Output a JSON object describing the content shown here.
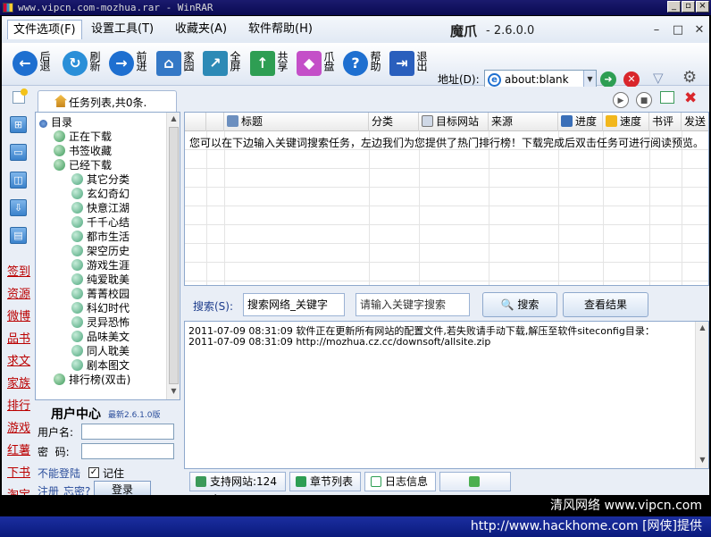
{
  "window": {
    "outer_title": "www.vipcn.com-mozhua.rar - WinRAR",
    "app_name": "魔爪",
    "app_version": "- 2.6.0.0"
  },
  "menu": [
    {
      "label": "文件选项(F)"
    },
    {
      "label": "设置工具(T)"
    },
    {
      "label": "收藏夹(A)"
    },
    {
      "label": "软件帮助(H)"
    }
  ],
  "toolbar": [
    {
      "label": "后退",
      "icon": "back-arrow-icon",
      "color": "#1e6fd0"
    },
    {
      "label": "刷新",
      "icon": "refresh-icon",
      "color": "#2a8fd8"
    },
    {
      "label": "前进",
      "icon": "forward-arrow-icon",
      "color": "#1e6fd0"
    },
    {
      "label": "家园",
      "icon": "home-icon",
      "color": "#3478c6"
    },
    {
      "label": "全屏",
      "icon": "fullscreen-icon",
      "color": "#2d8ab6"
    },
    {
      "label": "共享",
      "icon": "share-icon",
      "color": "#2e9e53"
    },
    {
      "label": "爪盘",
      "icon": "cube-icon",
      "color": "#c44fc8"
    },
    {
      "label": "帮助",
      "icon": "help-icon",
      "color": "#1e6fd0"
    },
    {
      "label": "退出",
      "icon": "exit-icon",
      "color": "#2a5fbd"
    }
  ],
  "address": {
    "label": "地址(D):",
    "value": "about:blank"
  },
  "task_tab": {
    "label": "任务列表,共0条."
  },
  "sidebar_links": [
    "签到",
    "资源",
    "微博",
    "品书",
    "求文",
    "家族",
    "排行",
    "游戏",
    "红薯",
    "下书",
    "淘宝"
  ],
  "tree": {
    "root": "目录",
    "items": [
      {
        "label": "正在下载",
        "level": 1
      },
      {
        "label": "书签收藏",
        "level": 1
      },
      {
        "label": "已经下载",
        "level": 1
      },
      {
        "label": "其它分类",
        "level": 2
      },
      {
        "label": "玄幻奇幻",
        "level": 2
      },
      {
        "label": "快意江湖",
        "level": 2
      },
      {
        "label": "千千心结",
        "level": 2
      },
      {
        "label": "都市生活",
        "level": 2
      },
      {
        "label": "架空历史",
        "level": 2
      },
      {
        "label": "游戏生涯",
        "level": 2
      },
      {
        "label": "纯爱耽美",
        "level": 2
      },
      {
        "label": "菁菁校园",
        "level": 2
      },
      {
        "label": "科幻时代",
        "level": 2
      },
      {
        "label": "灵异恐怖",
        "level": 2
      },
      {
        "label": "品味美文",
        "level": 2
      },
      {
        "label": "同人耽美",
        "level": 2
      },
      {
        "label": "剧本图文",
        "level": 2
      },
      {
        "label": "排行榜(双击)",
        "level": 1
      }
    ]
  },
  "user_center": {
    "title": "用户中心",
    "version": "最新2.6.1.0版",
    "username_label": "用户名:",
    "password_label": "密  码:",
    "cannot_login": "不能登陆",
    "remember": "记住",
    "register": "注册",
    "forgot": "忘密?",
    "login": "登录"
  },
  "grid": {
    "columns": [
      "标题",
      "分类",
      "目标网站",
      "来源",
      "进度",
      "速度",
      "书评",
      "发送"
    ],
    "message": "您可以在下边输入关键词搜索任务，左边我们为您提供了热门排行榜！下载完成后双击任务可进行阅读预览。"
  },
  "search": {
    "label": "搜索(S):",
    "scope": "搜索网络_关键字",
    "placeholder": "请输入关键字搜索",
    "search_button": "搜索",
    "results_button": "查看结果"
  },
  "log": [
    "2011-07-09 08:31:09 软件正在更新所有网站的配置文件,若失败请手动下载,解压至软件siteconfig目录：",
    "2011-07-09 08:31:09 http://mozhua.cz.cc/downsoft/allsite.zip"
  ],
  "bottom_tabs": [
    {
      "label": "支持网站:124个"
    },
    {
      "label": "章节列表"
    },
    {
      "label": "日志信息"
    },
    {
      "label": ""
    }
  ],
  "watermark": {
    "line1": "清风网络 www.vipcn.com",
    "line2": "http://www.hackhome.com [网侠]提供"
  }
}
